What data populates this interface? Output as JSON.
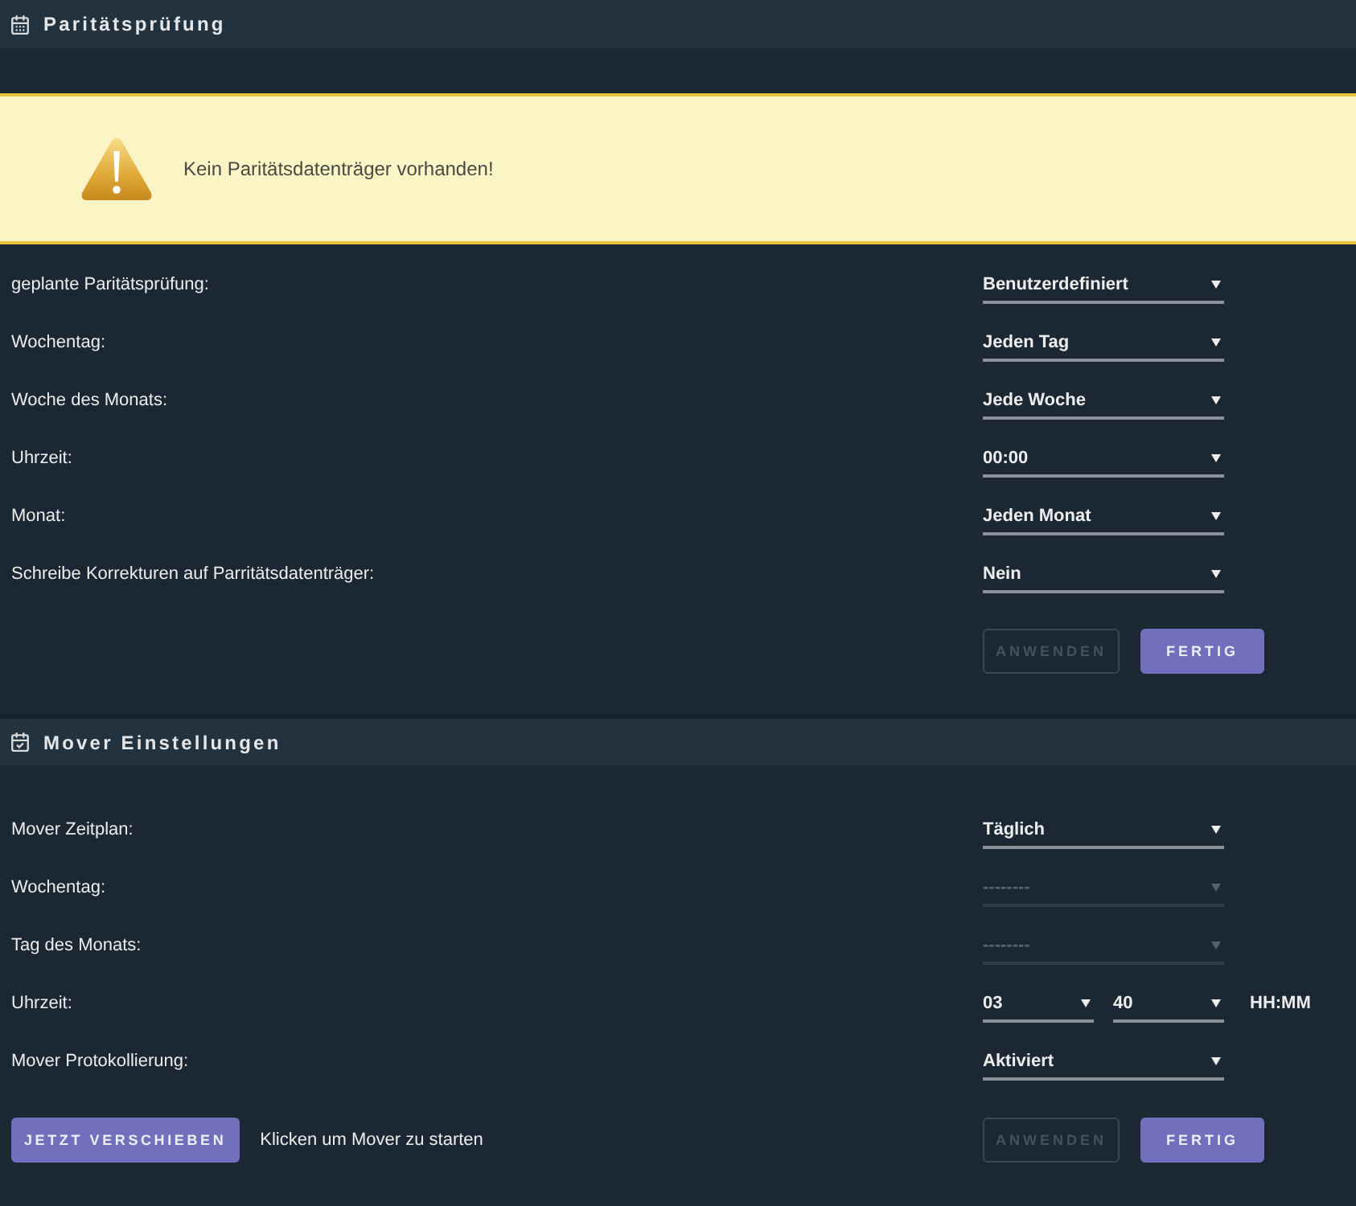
{
  "sections": [
    {
      "kind": "parity",
      "title": "Paritätsprüfung",
      "alert": {
        "text": "Kein Paritätsdatenträger vorhanden!"
      },
      "rows": [
        {
          "kind": "select",
          "label": "geplante Paritätsprüfung:",
          "value": "Benutzerdefiniert",
          "disabled": false
        },
        {
          "kind": "select",
          "label": "Wochentag:",
          "value": "Jeden Tag",
          "disabled": false
        },
        {
          "kind": "select",
          "label": "Woche des Monats:",
          "value": "Jede Woche",
          "disabled": false
        },
        {
          "kind": "select",
          "label": "Uhrzeit:",
          "value": "00:00",
          "disabled": false
        },
        {
          "kind": "select",
          "label": "Monat:",
          "value": "Jeden Monat",
          "disabled": false
        },
        {
          "kind": "select",
          "label": "Schreibe Korrekturen auf Parritätsdatenträger:",
          "value": "Nein",
          "disabled": false
        }
      ],
      "buttons": [
        {
          "label": "ANWENDEN",
          "disabled": true
        },
        {
          "label": "FERTIG",
          "disabled": false
        }
      ]
    },
    {
      "kind": "mover",
      "title": "Mover Einstellungen",
      "rows": [
        {
          "kind": "select",
          "label": "Mover Zeitplan:",
          "value": "Täglich",
          "disabled": false
        },
        {
          "kind": "select",
          "label": "Wochentag:",
          "value": "--------",
          "disabled": true
        },
        {
          "kind": "select",
          "label": "Tag des Monats:",
          "value": "--------",
          "disabled": true
        },
        {
          "kind": "time",
          "label": "Uhrzeit:",
          "fields": [
            {
              "value": "03",
              "disabled": false
            },
            {
              "value": "40",
              "disabled": false
            }
          ],
          "unit": "HH:MM"
        },
        {
          "kind": "select",
          "label": "Mover Protokollierung:",
          "value": "Aktiviert",
          "disabled": false
        }
      ],
      "run_button": {
        "label": "JETZT VERSCHIEBEN"
      },
      "run_hint": "Klicken um Mover zu starten",
      "buttons": [
        {
          "label": "ANWENDEN",
          "disabled": true
        },
        {
          "label": "FERTIG",
          "disabled": false
        }
      ]
    }
  ]
}
